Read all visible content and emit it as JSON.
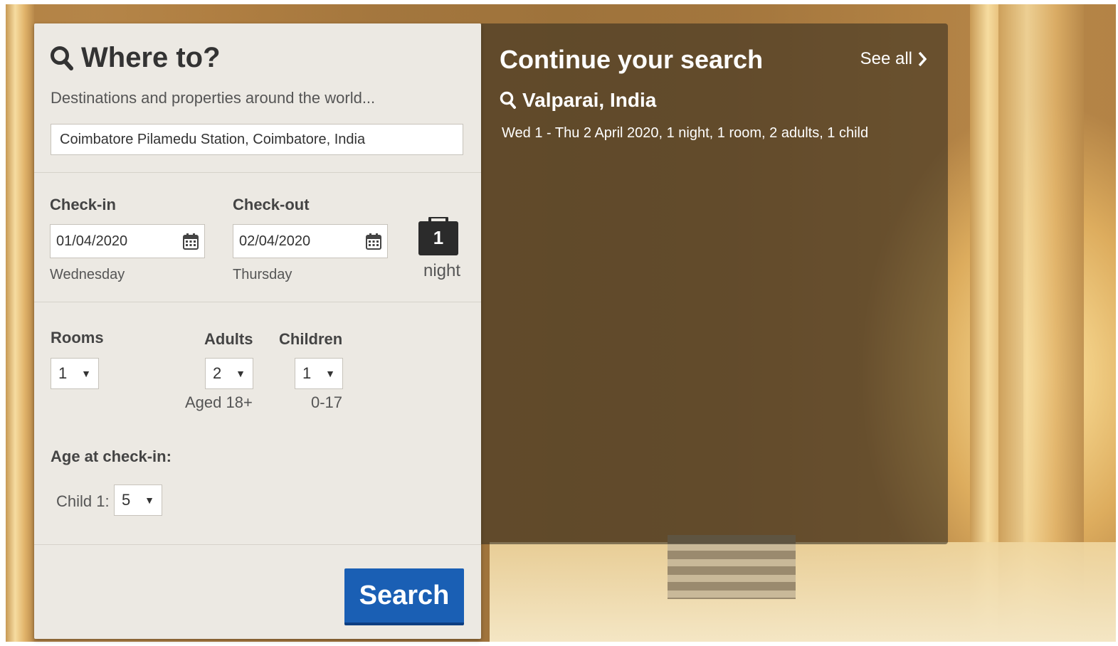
{
  "search": {
    "title": "Where to?",
    "subtitle": "Destinations and properties around the world...",
    "destination_value": "Coimbatore Pilamedu Station, Coimbatore, India"
  },
  "dates": {
    "checkin_label": "Check-in",
    "checkin_value": "01/04/2020",
    "checkin_day": "Wednesday",
    "checkout_label": "Check-out",
    "checkout_value": "02/04/2020",
    "checkout_day": "Thursday",
    "nights_count": "1",
    "nights_label": "night"
  },
  "occupancy": {
    "rooms_label": "Rooms",
    "rooms_value": "1",
    "adults_label": "Adults",
    "adults_value": "2",
    "adults_hint": "Aged 18+",
    "children_label": "Children",
    "children_value": "1",
    "children_hint": "0-17",
    "age_label": "Age at check-in:",
    "child1_label": "Child 1:",
    "child1_age": "5"
  },
  "actions": {
    "search_label": "Search"
  },
  "continue": {
    "title": "Continue your search",
    "see_all_label": "See all",
    "recent_location": "Valparai, India",
    "recent_details": "Wed 1 - Thu 2 April 2020, 1 night, 1 room, 2 adults, 1 child"
  },
  "icons": {
    "search": "search-icon",
    "calendar": "calendar-icon",
    "suitcase": "suitcase-icon",
    "chevron": "chevron-right-icon",
    "dropdown": "dropdown-arrow-icon"
  },
  "colors": {
    "accent": "#1a5fb4",
    "card_bg": "#ece9e3",
    "text_dark": "#333333"
  }
}
